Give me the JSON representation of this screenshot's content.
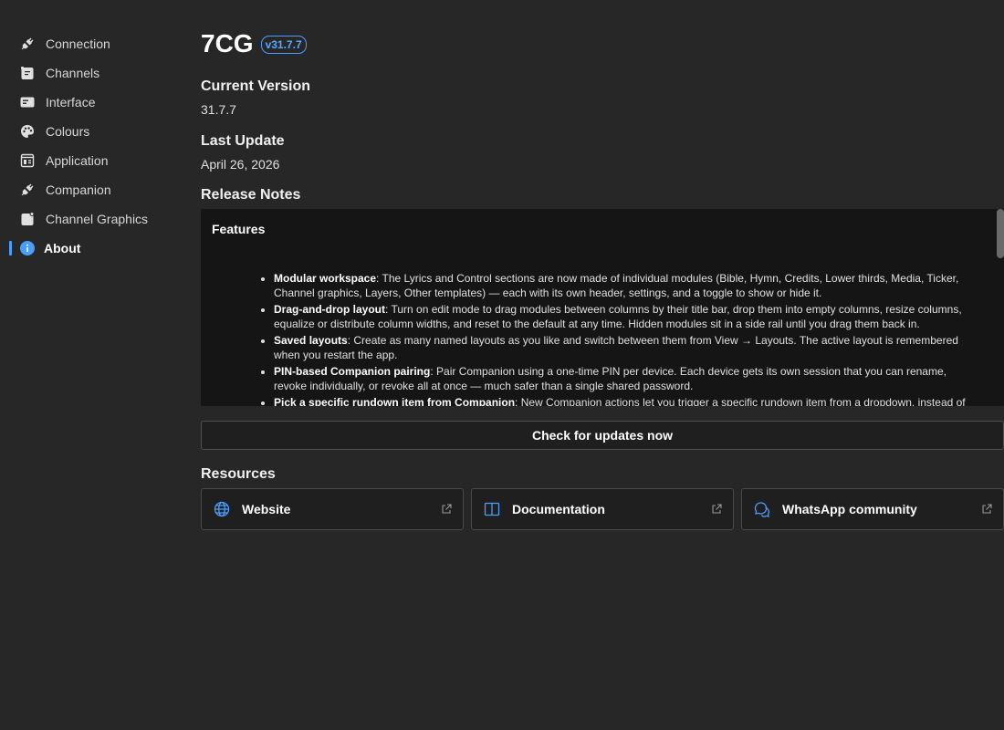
{
  "sidebar": {
    "items": [
      {
        "label": "Connection",
        "icon": "plug-icon"
      },
      {
        "label": "Channels",
        "icon": "channels-icon"
      },
      {
        "label": "Interface",
        "icon": "interface-icon"
      },
      {
        "label": "Colours",
        "icon": "palette-icon"
      },
      {
        "label": "Application",
        "icon": "application-icon"
      },
      {
        "label": "Companion",
        "icon": "plug-icon"
      },
      {
        "label": "Channel Graphics",
        "icon": "channel-graphics-icon"
      },
      {
        "label": "About",
        "icon": "info-icon",
        "active": true
      }
    ]
  },
  "header": {
    "title": "7CG",
    "version_badge": "v31.7.7"
  },
  "current_version": {
    "heading": "Current Version",
    "value": "31.7.7"
  },
  "last_update": {
    "heading": "Last Update",
    "value": "April 26, 2026"
  },
  "release_notes": {
    "heading": "Release Notes",
    "section_title": "Features",
    "items": [
      {
        "title": "Modular workspace",
        "text": ": The Lyrics and Control sections are now made of individual modules (Bible, Hymn, Credits, Lower thirds, Media, Ticker, Channel graphics, Layers, Other templates) — each with its own header, settings, and a toggle to show or hide it."
      },
      {
        "title": "Drag-and-drop layout",
        "text": ": Turn on edit mode to drag modules between columns by their title bar, drop them into empty columns, resize columns, equalize or distribute column widths, and reset to the default at any time. Hidden modules sit in a side rail until you drag them back in."
      },
      {
        "title": "Saved layouts",
        "text": ": Create as many named layouts as you like and switch between them from View → Layouts. The active layout is remembered when you restart the app."
      },
      {
        "title": "PIN-based Companion pairing",
        "text": ": Pair Companion using a one-time PIN per device. Each device gets its own session that you can rename, revoke individually, or revoke all at once — much safer than a single shared password."
      },
      {
        "title": "Pick a specific rundown item from Companion",
        "text": ": New Companion actions let you trigger a specific rundown item from a dropdown, instead of by position."
      }
    ]
  },
  "actions": {
    "check_updates_label": "Check for updates now"
  },
  "resources": {
    "heading": "Resources",
    "links": [
      {
        "label": "Website",
        "icon": "globe-icon"
      },
      {
        "label": "Documentation",
        "icon": "book-icon"
      },
      {
        "label": "WhatsApp community",
        "icon": "chat-icon"
      }
    ]
  },
  "colors": {
    "background": "#272727",
    "accent": "#4a9eff",
    "notes_background": "#151515"
  }
}
